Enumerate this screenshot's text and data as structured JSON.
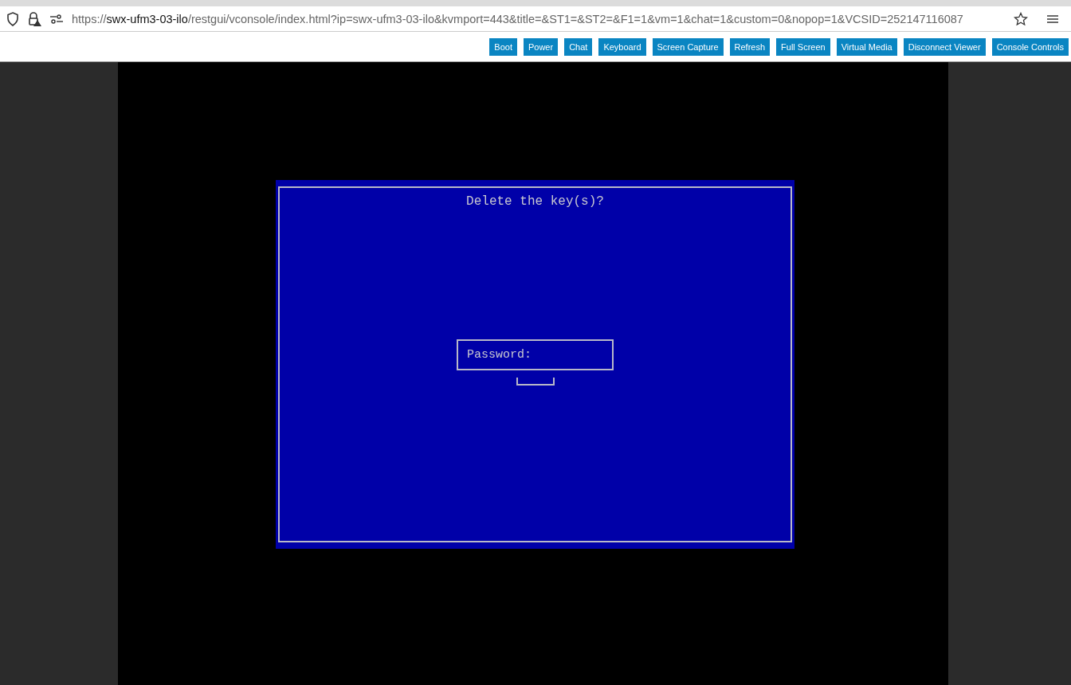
{
  "browser": {
    "url": "https://**swx-ufm3-03-ilo**/restgui/vconsole/index.html?ip=swx-ufm3-03-ilo&kvmport=443&title=&ST1=&ST2=&F1=1&vm=1&chat=1&custom=0&nopop=1&VCSID=252147116087"
  },
  "toolbar": {
    "buttons": [
      "Boot",
      "Power",
      "Chat",
      "Keyboard",
      "Screen Capture",
      "Refresh",
      "Full Screen",
      "Virtual Media",
      "Disconnect Viewer",
      "Console Controls"
    ]
  },
  "console": {
    "dialog": {
      "title": "Delete the key(s)?",
      "password_label": "Password:"
    }
  }
}
